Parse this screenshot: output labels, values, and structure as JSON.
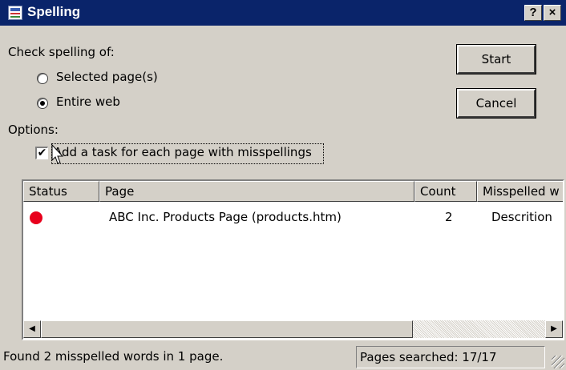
{
  "window": {
    "title": "Spelling",
    "help_btn": "?",
    "close_btn": "×"
  },
  "check_spelling": {
    "label": "Check spelling of:",
    "options": [
      {
        "label": "Selected page(s)",
        "selected": false
      },
      {
        "label": "Entire web",
        "selected": true
      }
    ]
  },
  "buttons": {
    "start": "Start",
    "cancel": "Cancel"
  },
  "options": {
    "label": "Options:",
    "add_task_label": "Add a task for each page with misspellings",
    "add_task_checked": true,
    "check_mark": "✔"
  },
  "results": {
    "columns": [
      "Status",
      "Page",
      "Count",
      "Misspelled w"
    ],
    "rows": [
      {
        "status": "red",
        "page": "ABC Inc. Products Page (products.htm)",
        "count": "2",
        "misspelled": "Descrition"
      }
    ]
  },
  "icons": {
    "scroll_left": "◀",
    "scroll_right": "▶"
  },
  "status": {
    "message": "Found 2 misspelled words in 1 page.",
    "pages_searched": "Pages searched: 17/17"
  },
  "colors": {
    "titlebar": "#0a246a",
    "dialog": "#d4d0c8",
    "error_dot": "#e8001c"
  }
}
